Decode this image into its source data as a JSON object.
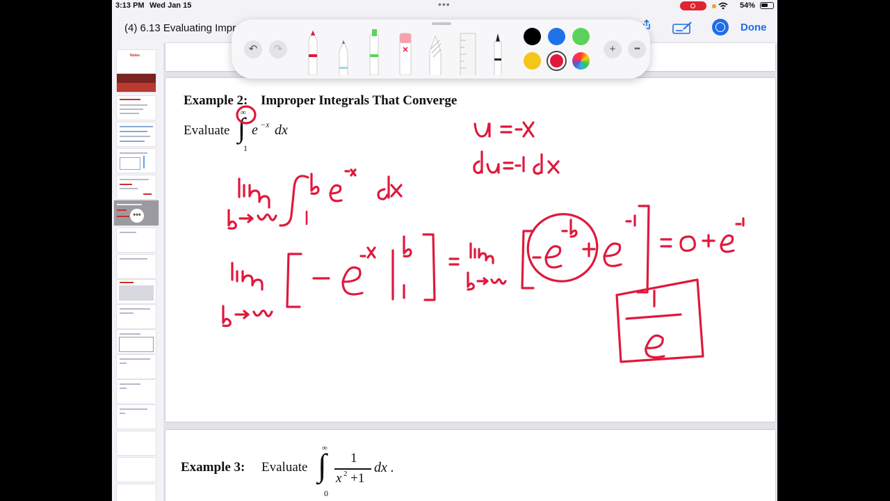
{
  "status_bar": {
    "time": "3:13 PM",
    "date": "Wed Jan 15",
    "more_dots": "•••",
    "battery": "54%"
  },
  "nav": {
    "title": "(4) 6.13 Evaluating Impr",
    "done_label": "Done"
  },
  "toolbar": {
    "undo": "↶",
    "redo": "↷",
    "add": "+",
    "more": "•••",
    "tools": [
      "pen",
      "pencil",
      "highlighter",
      "eraser",
      "lasso",
      "ruler",
      "fountain-pen"
    ],
    "colors": [
      "#000000",
      "#1e73e8",
      "#5bd35b",
      "#f5c518",
      "#e0183c"
    ],
    "selected_color": "#e0183c"
  },
  "thumbnails": {
    "first_title": "Notes",
    "more": "•••"
  },
  "document": {
    "example2": {
      "title": "Example 2:",
      "subtitle": "Improper Integrals That Converge",
      "evaluate": "Evaluate",
      "upper": "∞",
      "lower": "1",
      "integrand": "e",
      "exponent": "−x",
      "dx": "dx"
    },
    "example3": {
      "title": "Example 3:",
      "evaluate": "Evaluate",
      "upper": "∞",
      "lower": "0",
      "numerator": "1",
      "denominator": "x",
      "denominator_exp": "2",
      "denominator_rest": "+1",
      "dx": "dx ."
    }
  },
  "ink_color": "#e0183c"
}
